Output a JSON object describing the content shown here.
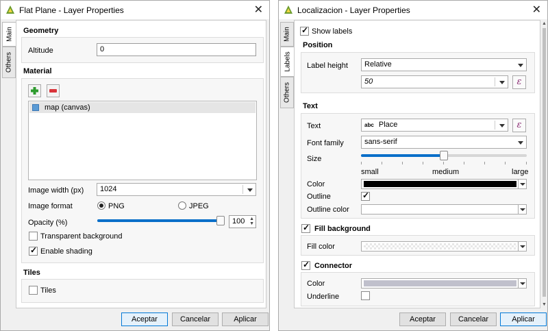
{
  "left_window": {
    "title": "Flat Plane - Layer Properties",
    "tabs": [
      "Main",
      "Others"
    ],
    "geometry": {
      "heading": "Geometry",
      "altitude_label": "Altitude",
      "altitude_value": "0"
    },
    "material": {
      "heading": "Material",
      "layers": [
        "map (canvas)"
      ],
      "image_width_label": "Image width (px)",
      "image_width_value": "1024",
      "image_format_label": "Image format",
      "format_png": "PNG",
      "format_jpeg": "JPEG",
      "opacity_label": "Opacity (%)",
      "opacity_value": "100",
      "opacity_fraction": 1.0,
      "transparent_background": "Transparent background",
      "enable_shading": "Enable shading"
    },
    "tiles": {
      "heading": "Tiles",
      "tiles_label": "Tiles"
    },
    "buttons": {
      "accept": "Aceptar",
      "cancel": "Cancelar",
      "apply": "Aplicar"
    }
  },
  "right_window": {
    "title": "Localizacion - Layer Properties",
    "tabs": [
      "Main",
      "Labels",
      "Others"
    ],
    "show_labels": "Show labels",
    "position": {
      "heading": "Position",
      "label_height_label": "Label height",
      "label_height_value": "Relative",
      "height_value": "50"
    },
    "text": {
      "heading": "Text",
      "text_label": "Text",
      "text_prefix": "abc",
      "text_value": "Place",
      "font_family_label": "Font family",
      "font_family_value": "sans-serif",
      "size_label": "Size",
      "size_fraction": 0.5,
      "size_small": "small",
      "size_medium": "medium",
      "size_large": "large",
      "color_label": "Color",
      "color_hex": "#000000",
      "outline_label": "Outline",
      "outline_color_label": "Outline color",
      "outline_color_hex": "#ffffff"
    },
    "fill_background": {
      "heading": "Fill background",
      "fill_color_label": "Fill color"
    },
    "connector": {
      "heading": "Connector",
      "color_label": "Color",
      "color_hex": "#c0c0cc",
      "underline_label": "Underline"
    },
    "buttons": {
      "accept": "Aceptar",
      "cancel": "Cancelar",
      "apply": "Aplicar"
    }
  }
}
